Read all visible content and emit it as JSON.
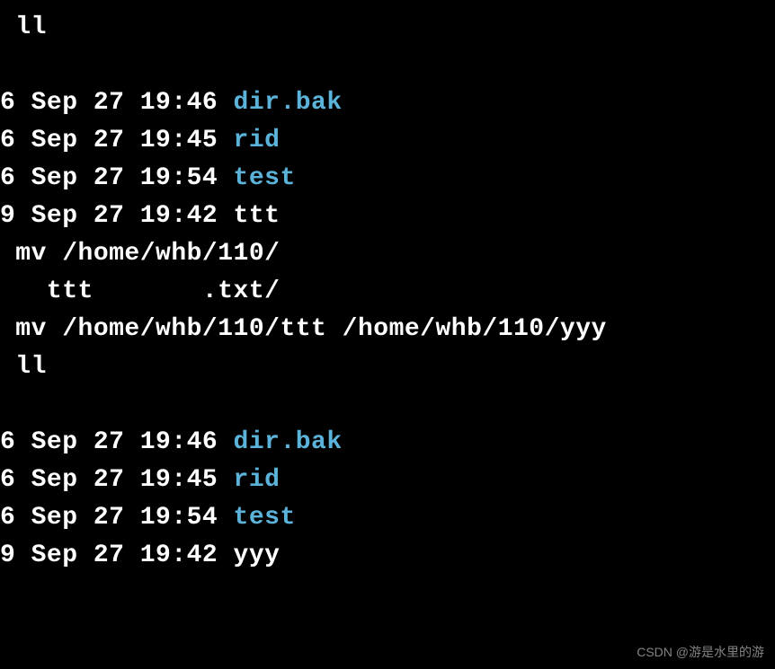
{
  "commands": {
    "ll1": " ll",
    "ll2": " ll",
    "mv_partial": " mv /home/whb/110/",
    "completion": "   ttt       .txt/",
    "mv_full": " mv /home/whb/110/ttt /home/whb/110/yyy"
  },
  "listing1": [
    {
      "prefix": "6 Sep 27 19:46 ",
      "name": "dir.bak",
      "type": "dir"
    },
    {
      "prefix": "6 Sep 27 19:45 ",
      "name": "rid",
      "type": "dir"
    },
    {
      "prefix": "6 Sep 27 19:54 ",
      "name": "test",
      "type": "dir"
    },
    {
      "prefix": "9 Sep 27 19:42 ",
      "name": "ttt",
      "type": "txt"
    }
  ],
  "listing2": [
    {
      "prefix": "6 Sep 27 19:46 ",
      "name": "dir.bak",
      "type": "dir"
    },
    {
      "prefix": "6 Sep 27 19:45 ",
      "name": "rid",
      "type": "dir"
    },
    {
      "prefix": "6 Sep 27 19:54 ",
      "name": "test",
      "type": "dir"
    },
    {
      "prefix": "9 Sep 27 19:42 ",
      "name": "yyy",
      "type": "txt"
    }
  ],
  "watermark": "CSDN @游是水里的游"
}
